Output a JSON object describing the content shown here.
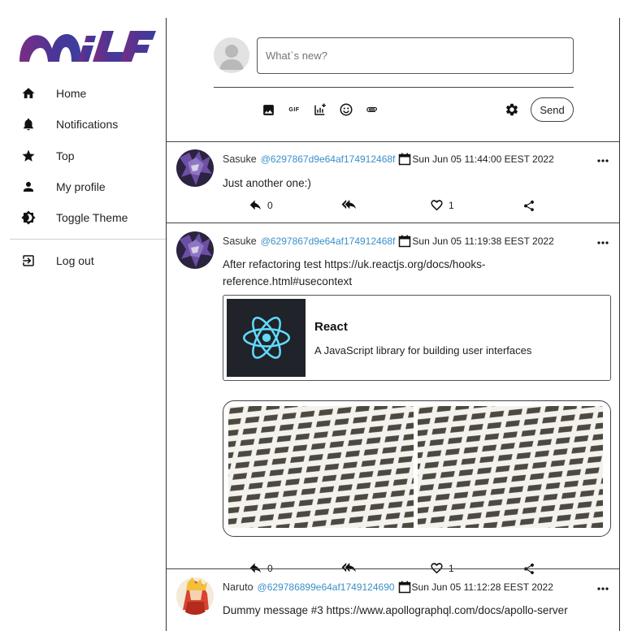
{
  "logo": {
    "text": "MILF"
  },
  "sidebar": {
    "items": [
      {
        "label": "Home",
        "icon": "home-icon"
      },
      {
        "label": "Notifications",
        "icon": "bell-icon"
      },
      {
        "label": "Top",
        "icon": "star-icon"
      },
      {
        "label": "My profile",
        "icon": "person-icon"
      },
      {
        "label": "Toggle Theme",
        "icon": "brightness-icon"
      }
    ],
    "logout": {
      "label": "Log out",
      "icon": "logout-icon"
    }
  },
  "composer": {
    "placeholder": "What`s new?",
    "tools": [
      "image-icon",
      "gif-icon",
      "poll-icon",
      "emoji-icon",
      "attach-icon",
      "settings-icon"
    ],
    "gif_label": "GIF",
    "send_label": "Send"
  },
  "posts": [
    {
      "author": "Sasuke",
      "handle": "@6297867d9e64af174912468f",
      "date": "Sun Jun 05 11:44:00 EEST 2022",
      "text": [
        "Just another one:)"
      ],
      "replies": "0",
      "likes": "1"
    },
    {
      "author": "Sasuke",
      "handle": "@6297867d9e64af174912468f",
      "date": "Sun Jun 05 11:19:38 EEST 2022",
      "text": [
        "After refactoring test https://uk.reactjs.org/docs/hooks-",
        "reference.html#usecontext"
      ],
      "link_preview": {
        "title": "React",
        "description": "A JavaScript library for building user interfaces"
      },
      "replies": "0",
      "likes": "1"
    },
    {
      "author": "Naruto",
      "handle": "@629786899e64af1749124690",
      "date": "Sun Jun 05 11:12:28 EEST 2022",
      "text": [
        "Dummy message #3 https://www.apollographql.com/docs/apollo-server"
      ]
    }
  ],
  "colors": {
    "accent_handle": "#3b8fc9",
    "logo_gradient_start": "#6a2a7a",
    "logo_gradient_end": "#3a3a9a",
    "react_blue": "#61dafb",
    "react_bg": "#20232a"
  }
}
